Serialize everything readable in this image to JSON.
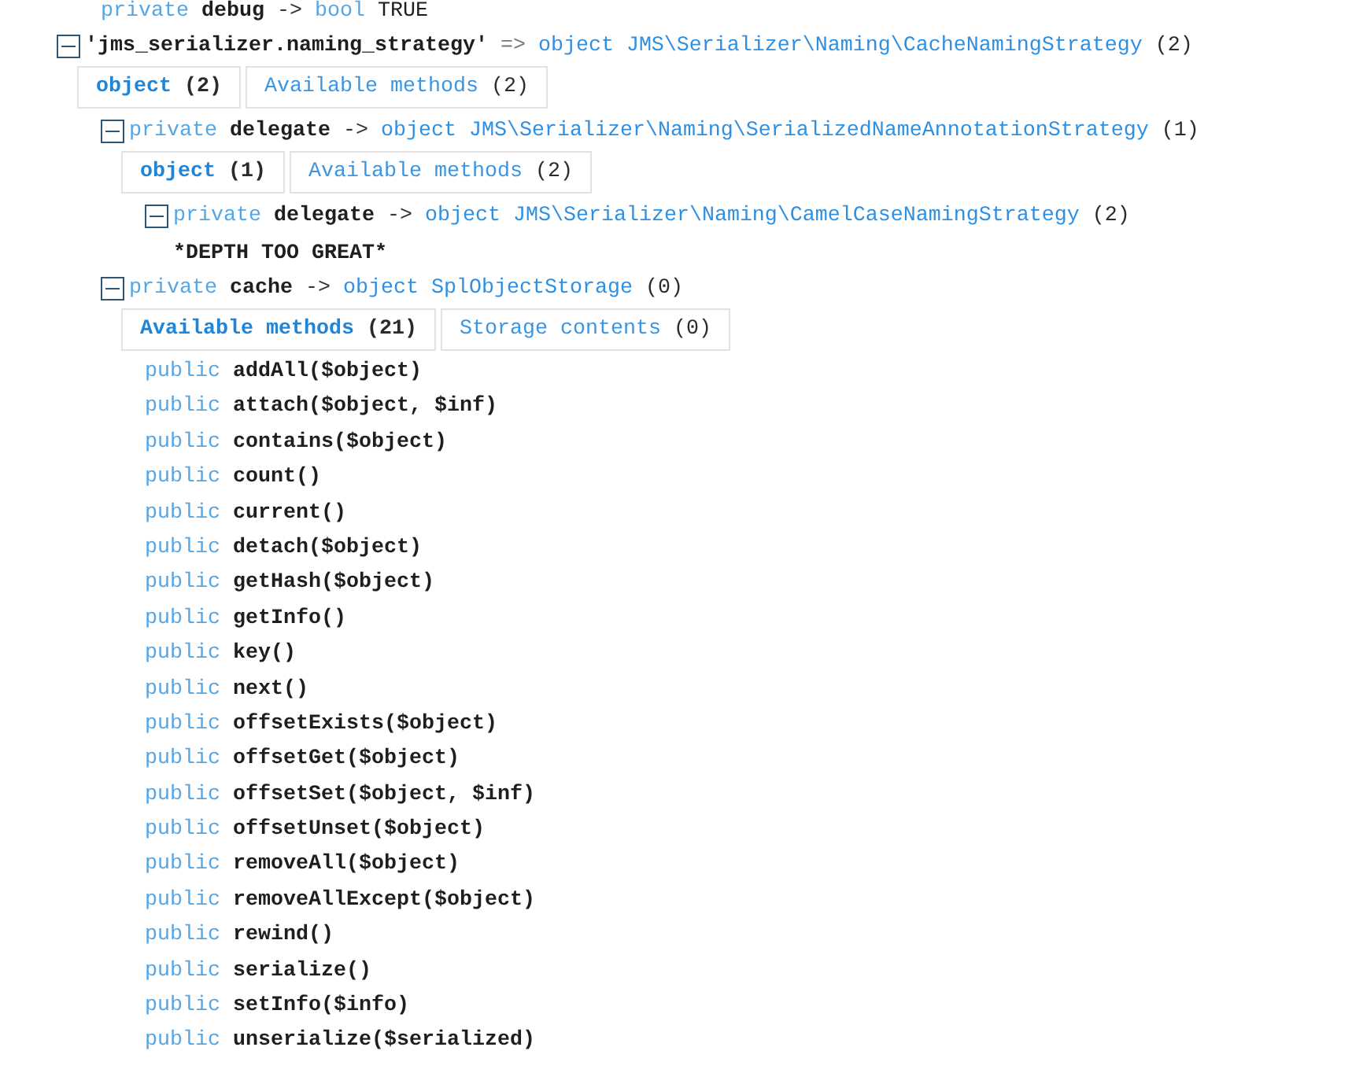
{
  "preceding_properties": [
    {
      "kind": "property",
      "visibility": "private",
      "name": "debug",
      "operator": "->",
      "type": "bool",
      "value": "TRUE"
    }
  ],
  "entries": [
    {
      "kind": "node",
      "name": "'jms_serializer.naming_strategy'",
      "operator": "=>",
      "type": "object",
      "class": "JMS\\Serializer\\Naming\\CacheNamingStrategy",
      "count": "(2)",
      "expanded": true,
      "tabs": [
        {
          "label": "object",
          "count": "(2)",
          "selected": true
        },
        {
          "label": "Available methods",
          "count": "(2)",
          "selected": false
        }
      ],
      "children": [
        {
          "kind": "node",
          "visibility": "private",
          "name": "delegate",
          "operator": "->",
          "type": "object",
          "class": "JMS\\Serializer\\Naming\\SerializedNameAnnotationStrategy",
          "count": "(1)",
          "expanded": true,
          "tabs": [
            {
              "label": "object",
              "count": "(1)",
              "selected": true
            },
            {
              "label": "Available methods",
              "count": "(2)",
              "selected": false
            }
          ],
          "children": [
            {
              "kind": "node",
              "visibility": "private",
              "name": "delegate",
              "operator": "->",
              "type": "object",
              "class": "JMS\\Serializer\\Naming\\CamelCaseNamingStrategy",
              "count": "(2)",
              "expanded": true,
              "children": [
                {
                  "kind": "note",
                  "text": "*DEPTH TOO GREAT*"
                }
              ]
            }
          ]
        },
        {
          "kind": "node",
          "visibility": "private",
          "name": "cache",
          "operator": "->",
          "type": "object",
          "class": "SplObjectStorage",
          "count": "(0)",
          "expanded": true,
          "tabs": [
            {
              "label": "Available methods",
              "count": "(21)",
              "selected": true
            },
            {
              "label": "Storage contents",
              "count": "(0)",
              "selected": false
            }
          ],
          "children": [
            {
              "kind": "method",
              "visibility": "public",
              "signature": "addAll($object)"
            },
            {
              "kind": "method",
              "visibility": "public",
              "signature": "attach($object, $inf)"
            },
            {
              "kind": "method",
              "visibility": "public",
              "signature": "contains($object)"
            },
            {
              "kind": "method",
              "visibility": "public",
              "signature": "count()"
            },
            {
              "kind": "method",
              "visibility": "public",
              "signature": "current()"
            },
            {
              "kind": "method",
              "visibility": "public",
              "signature": "detach($object)"
            },
            {
              "kind": "method",
              "visibility": "public",
              "signature": "getHash($object)"
            },
            {
              "kind": "method",
              "visibility": "public",
              "signature": "getInfo()"
            },
            {
              "kind": "method",
              "visibility": "public",
              "signature": "key()"
            },
            {
              "kind": "method",
              "visibility": "public",
              "signature": "next()"
            },
            {
              "kind": "method",
              "visibility": "public",
              "signature": "offsetExists($object)"
            },
            {
              "kind": "method",
              "visibility": "public",
              "signature": "offsetGet($object)"
            },
            {
              "kind": "method",
              "visibility": "public",
              "signature": "offsetSet($object, $inf)"
            },
            {
              "kind": "method",
              "visibility": "public",
              "signature": "offsetUnset($object)"
            },
            {
              "kind": "method",
              "visibility": "public",
              "signature": "removeAll($object)"
            },
            {
              "kind": "method",
              "visibility": "public",
              "signature": "removeAllExcept($object)"
            },
            {
              "kind": "method",
              "visibility": "public",
              "signature": "rewind()"
            },
            {
              "kind": "method",
              "visibility": "public",
              "signature": "serialize()"
            },
            {
              "kind": "method",
              "visibility": "public",
              "signature": "setInfo($info)"
            },
            {
              "kind": "method",
              "visibility": "public",
              "signature": "unserialize($serialized)"
            }
          ]
        }
      ]
    }
  ]
}
